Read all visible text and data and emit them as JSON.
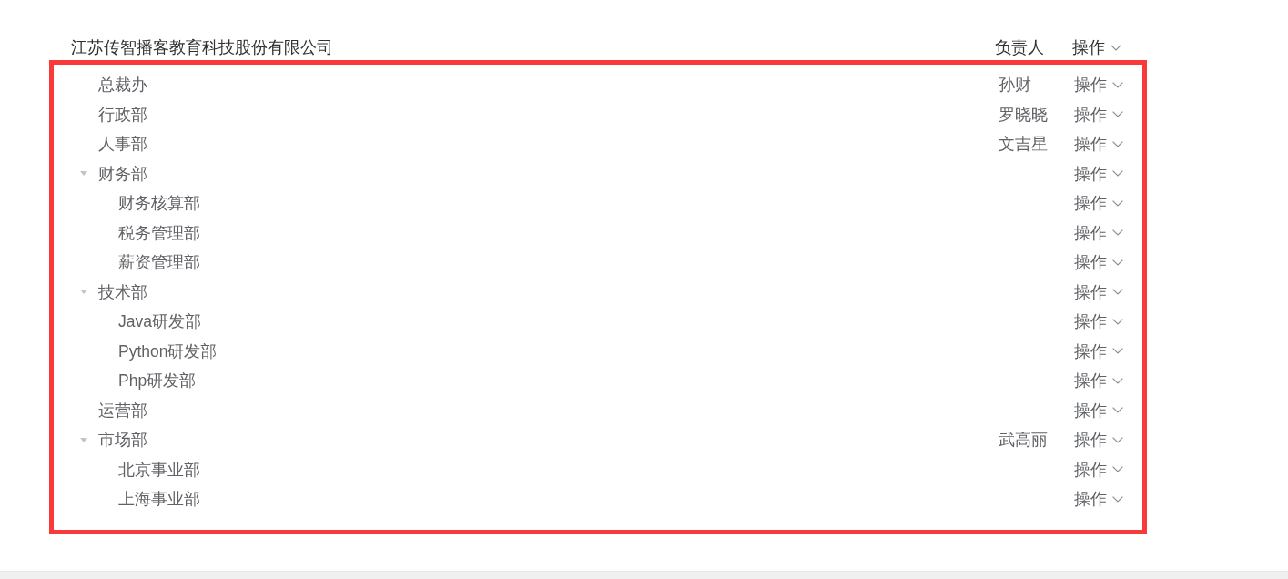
{
  "company": {
    "name": "江苏传智播客教育科技股份有限公司",
    "manager": "负责人",
    "action": "操作"
  },
  "departments": [
    {
      "name": "总裁办",
      "manager": "孙财",
      "action": "操作"
    },
    {
      "name": "行政部",
      "manager": "罗晓晓",
      "action": "操作"
    },
    {
      "name": "人事部",
      "manager": "文吉星",
      "action": "操作"
    },
    {
      "name": "财务部",
      "expanded": true,
      "action": "操作",
      "children": [
        {
          "name": "财务核算部",
          "action": "操作"
        },
        {
          "name": "税务管理部",
          "action": "操作"
        },
        {
          "name": "薪资管理部",
          "action": "操作"
        }
      ]
    },
    {
      "name": "技术部",
      "expanded": true,
      "action": "操作",
      "children": [
        {
          "name": "Java研发部",
          "action": "操作"
        },
        {
          "name": "Python研发部",
          "action": "操作"
        },
        {
          "name": "Php研发部",
          "action": "操作"
        }
      ]
    },
    {
      "name": "运营部",
      "action": "操作"
    },
    {
      "name": "市场部",
      "manager": "武高丽",
      "expanded": true,
      "action": "操作",
      "children": [
        {
          "name": "北京事业部",
          "action": "操作"
        },
        {
          "name": "上海事业部",
          "action": "操作"
        }
      ]
    }
  ]
}
